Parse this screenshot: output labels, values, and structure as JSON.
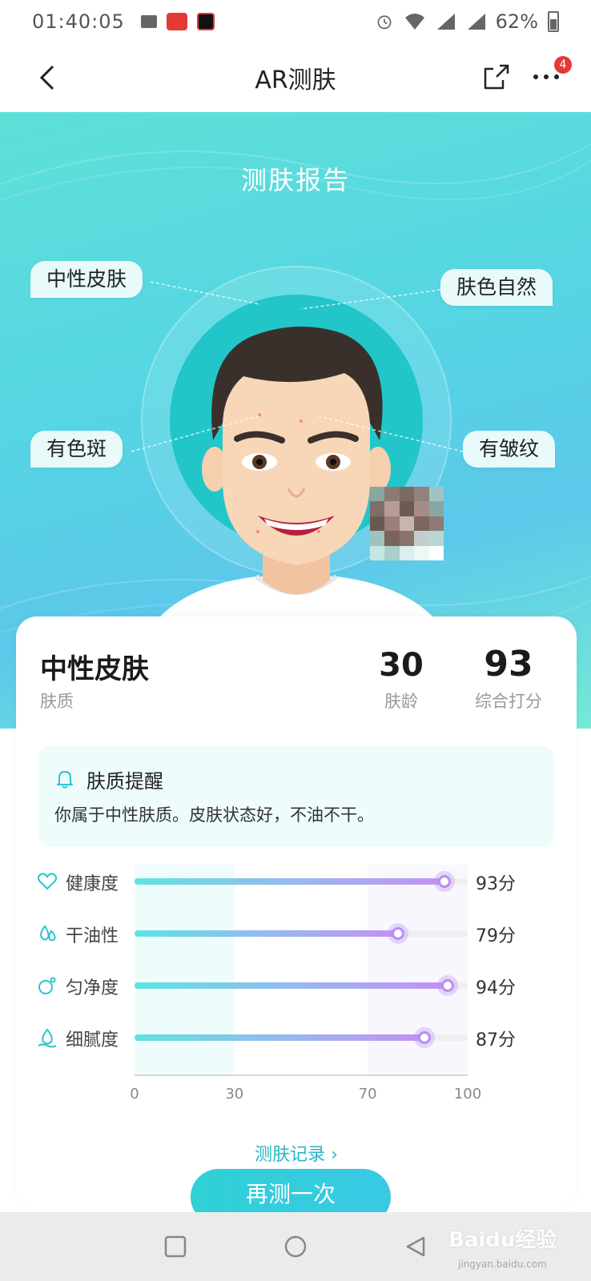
{
  "status_bar": {
    "time": "01:40:05",
    "battery": "62%",
    "icons": [
      "mail-icon",
      "toutiao-app-icon",
      "video-app-icon",
      "alarm-icon",
      "wifi-icon",
      "signal-icon",
      "signal-icon",
      "battery-icon"
    ]
  },
  "nav": {
    "title": "AR测肤",
    "back_icon": "chevron-left-icon",
    "share_icon": "share-icon",
    "more_icon": "more-icon",
    "more_badge": "4"
  },
  "hero": {
    "title": "测肤报告",
    "tags": {
      "top_left": "中性皮肤",
      "top_right": "肤色自然",
      "bottom_left": "有色斑",
      "bottom_right": "有皱纹"
    }
  },
  "summary": {
    "skin_type": "中性皮肤",
    "skin_type_label": "肤质",
    "skin_age": "30",
    "skin_age_label": "肤龄",
    "overall_score": "93",
    "overall_score_label": "综合打分"
  },
  "reminder": {
    "icon": "bell-icon",
    "title": "肤质提醒",
    "text": "你属于中性肤质。皮肤状态好，不油不干。"
  },
  "chart_data": {
    "type": "bar",
    "categories": [
      "健康度",
      "干油性",
      "匀净度",
      "细腻度"
    ],
    "values": [
      93,
      79,
      94,
      87
    ],
    "value_labels": [
      "93分",
      "79分",
      "94分",
      "87分"
    ],
    "xlim": [
      0,
      100
    ],
    "ticks": [
      "0",
      "30",
      "70",
      "100"
    ],
    "icons": [
      "heart-icon",
      "droplet-icon",
      "sparkle-face-icon",
      "water-drop-icon"
    ],
    "colors": {
      "start": "#5fe3e0",
      "end": "#c391f3"
    }
  },
  "actions": {
    "history_link": "测肤记录 ›",
    "retest_button": "再测一次"
  },
  "system_nav": {
    "icons": [
      "square-icon",
      "circle-icon",
      "triangle-back-icon"
    ]
  },
  "watermark": {
    "text": "Baidu经验",
    "sub": "jingyan.baidu.com"
  }
}
